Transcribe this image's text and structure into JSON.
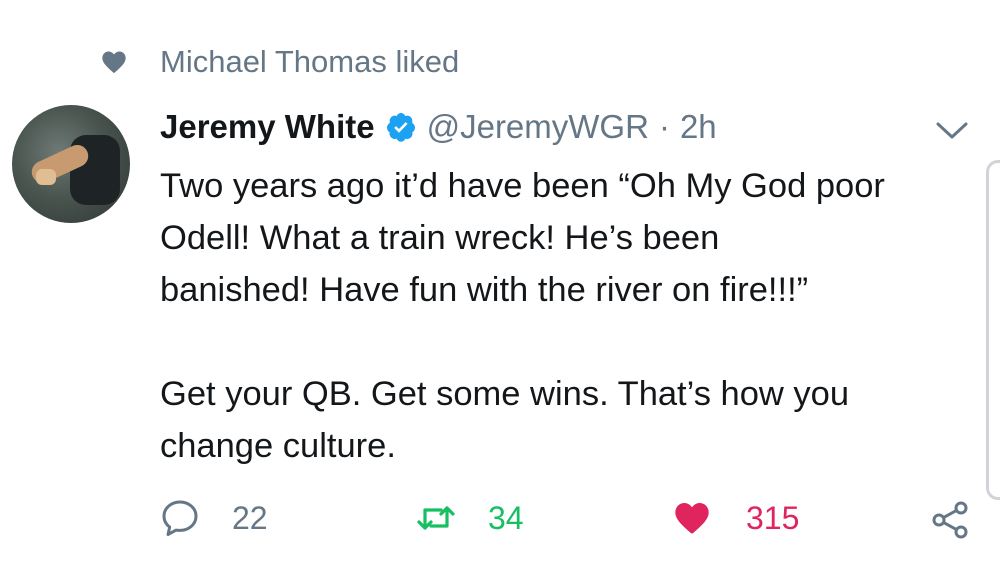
{
  "social_context": {
    "icon": "heart-icon",
    "text": "Michael Thomas liked"
  },
  "tweet": {
    "author_name": "Jeremy White",
    "verified": true,
    "handle": "@JeremyWGR",
    "separator": "·",
    "time": "2h",
    "text_lines_1": [
      "Two years ago it’d have been “Oh My God poor",
      "Odell!  What a train wreck!  He’s been",
      "banished!  Have fun with the river on fire!!!”"
    ],
    "text_lines_2": [
      "Get your QB. Get some wins. That’s how you",
      "change culture."
    ]
  },
  "actions": {
    "reply_count": "22",
    "retweet_count": "34",
    "like_count": "315"
  },
  "colors": {
    "secondary_text": "#657786",
    "verified_blue": "#1da1f2",
    "retweet_green": "#17bf63",
    "like_red": "#e0245e"
  }
}
